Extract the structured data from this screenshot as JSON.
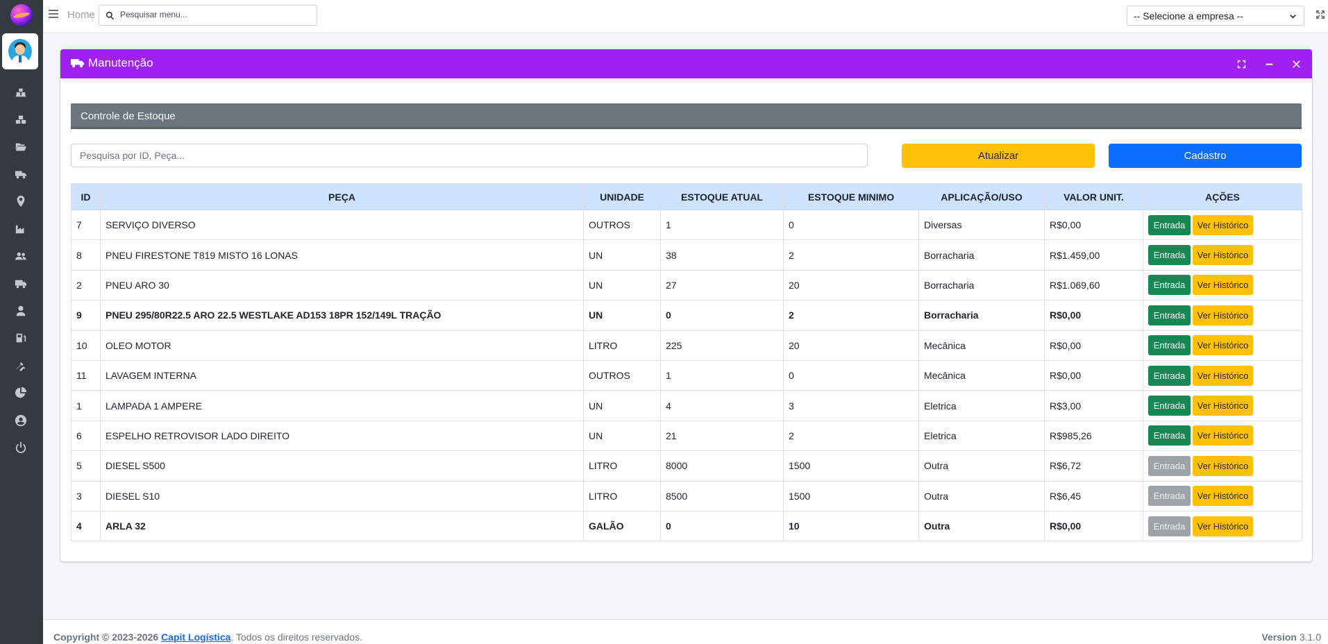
{
  "topbar": {
    "home_label": "Home",
    "search_placeholder": "Pesquisar menu...",
    "company_select_value": "-- Selecione a empresa --"
  },
  "card": {
    "title": "Manutenção",
    "header_color": "#a020f0",
    "section_title": "Controle de Estoque",
    "search_placeholder": "Pesquisa por ID, Peça...",
    "refresh_label": "Atualizar",
    "register_label": "Cadastro"
  },
  "table": {
    "columns": [
      "ID",
      "PEÇA",
      "UNIDADE",
      "ESTOQUE ATUAL",
      "ESTOQUE MINIMO",
      "APLICAÇÃO/USO",
      "VALOR UNIT.",
      "AÇÕES"
    ],
    "entry_label": "Entrada",
    "history_label": "Ver Histórico",
    "rows": [
      {
        "id": "7",
        "part": "SERVIÇO DIVERSO",
        "unit": "OUTROS",
        "stock": "1",
        "min": "0",
        "use": "Diversas",
        "price": "R$0,00"
      },
      {
        "id": "8",
        "part": "PNEU FIRESTONE T819 MISTO 16 LONAS",
        "unit": "UN",
        "stock": "38",
        "min": "2",
        "use": "Borracharia",
        "price": "R$1.459,00"
      },
      {
        "id": "2",
        "part": "PNEU ARO 30",
        "unit": "UN",
        "stock": "27",
        "min": "20",
        "use": "Borracharia",
        "price": "R$1.069,60"
      },
      {
        "id": "9",
        "part": "PNEU 295/80R22.5 ARO 22.5 WESTLAKE AD153 18PR 152/149L TRAÇÃO",
        "unit": "UN",
        "stock": "0",
        "min": "2",
        "use": "Borracharia",
        "price": "R$0,00"
      },
      {
        "id": "10",
        "part": "OLEO MOTOR",
        "unit": "LITRO",
        "stock": "225",
        "min": "20",
        "use": "Mecânica",
        "price": "R$0,00"
      },
      {
        "id": "11",
        "part": "LAVAGEM INTERNA",
        "unit": "OUTROS",
        "stock": "1",
        "min": "0",
        "use": "Mecânica",
        "price": "R$0,00"
      },
      {
        "id": "1",
        "part": "LAMPADA 1 AMPERE",
        "unit": "UN",
        "stock": "4",
        "min": "3",
        "use": "Eletrica",
        "price": "R$3,00"
      },
      {
        "id": "6",
        "part": "ESPELHO RETROVISOR LADO DIREITO",
        "unit": "UN",
        "stock": "21",
        "min": "2",
        "use": "Eletrica",
        "price": "R$985,26"
      },
      {
        "id": "5",
        "part": "DIESEL S500",
        "unit": "LITRO",
        "stock": "8000",
        "min": "1500",
        "use": "Outra",
        "price": "R$6,72"
      },
      {
        "id": "3",
        "part": "DIESEL S10",
        "unit": "LITRO",
        "stock": "8500",
        "min": "1500",
        "use": "Outra",
        "price": "R$6,45"
      },
      {
        "id": "4",
        "part": "ARLA 32",
        "unit": "GALÃO",
        "stock": "0",
        "min": "10",
        "use": "Outra",
        "price": "R$0,00"
      }
    ]
  },
  "footer": {
    "copyright": "Copyright © 2023-2026",
    "company_link": "Capit Logística",
    "rights": ". Todos os direitos reservados.",
    "version_label": "Version",
    "version_value": "3.1.0"
  }
}
